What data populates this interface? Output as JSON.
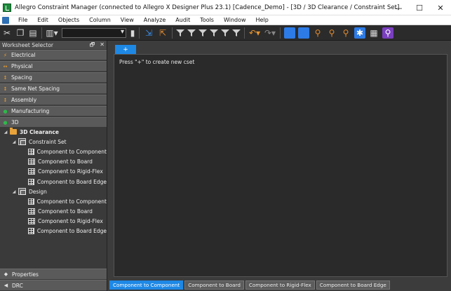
{
  "window": {
    "title": "Allegro Constraint Manager (connected to Allegro X Designer Plus 23.1) [Cadence_Demo] - [3D / 3D Clearance / Constraint Set]",
    "minimize": "—",
    "maximize": "☐",
    "close": "✕"
  },
  "menu": {
    "items": [
      "File",
      "Edit",
      "Objects",
      "Column",
      "View",
      "Analyze",
      "Audit",
      "Tools",
      "Window",
      "Help"
    ]
  },
  "toolbar": {
    "combo_value": "",
    "icons": [
      "scissors-icon",
      "copy-icon",
      "paste-icon",
      "filter-icon",
      "undo-icon",
      "redo-icon",
      "analyze-icon",
      "settings-icon",
      "spreadsheet-icon",
      "search-icon"
    ]
  },
  "worksheet_selector": {
    "title": "Worksheet Selector",
    "pin": "🗗",
    "close": "✕",
    "categories": [
      {
        "label": "Electrical",
        "icon": "⚡",
        "color": "#f0a030"
      },
      {
        "label": "Physical",
        "icon": "↔",
        "color": "#f0a030"
      },
      {
        "label": "Spacing",
        "icon": "↕",
        "color": "#f0a030"
      },
      {
        "label": "Same Net Spacing",
        "icon": "↕",
        "color": "#f0a030"
      },
      {
        "label": "Assembly",
        "icon": "↕",
        "color": "#f0a030"
      },
      {
        "label": "Manufacturing",
        "icon": "●",
        "color": "#2fb84a"
      },
      {
        "label": "3D",
        "icon": "●",
        "color": "#2fb84a"
      }
    ],
    "tree": {
      "root": "3D Clearance",
      "groups": [
        {
          "label": "Constraint Set",
          "items": [
            "Component to Component",
            "Component to Board",
            "Component to Rigid-Flex",
            "Component to Board Edge"
          ]
        },
        {
          "label": "Design",
          "items": [
            "Component to Component",
            "Component to Board",
            "Component to Rigid-Flex",
            "Component to Board Edge"
          ]
        }
      ]
    },
    "bottom": [
      {
        "label": "Properties",
        "icon": "◆"
      },
      {
        "label": "DRC",
        "icon": "◀"
      }
    ]
  },
  "workspace": {
    "add_tab": "+",
    "hint": "Press \"+\" to create new cset"
  },
  "bottom_tabs": [
    {
      "label": "Component to Component",
      "active": true
    },
    {
      "label": "Component to Board",
      "active": false
    },
    {
      "label": "Component to Rigid-Flex",
      "active": false
    },
    {
      "label": "Component to Board Edge",
      "active": false
    }
  ]
}
